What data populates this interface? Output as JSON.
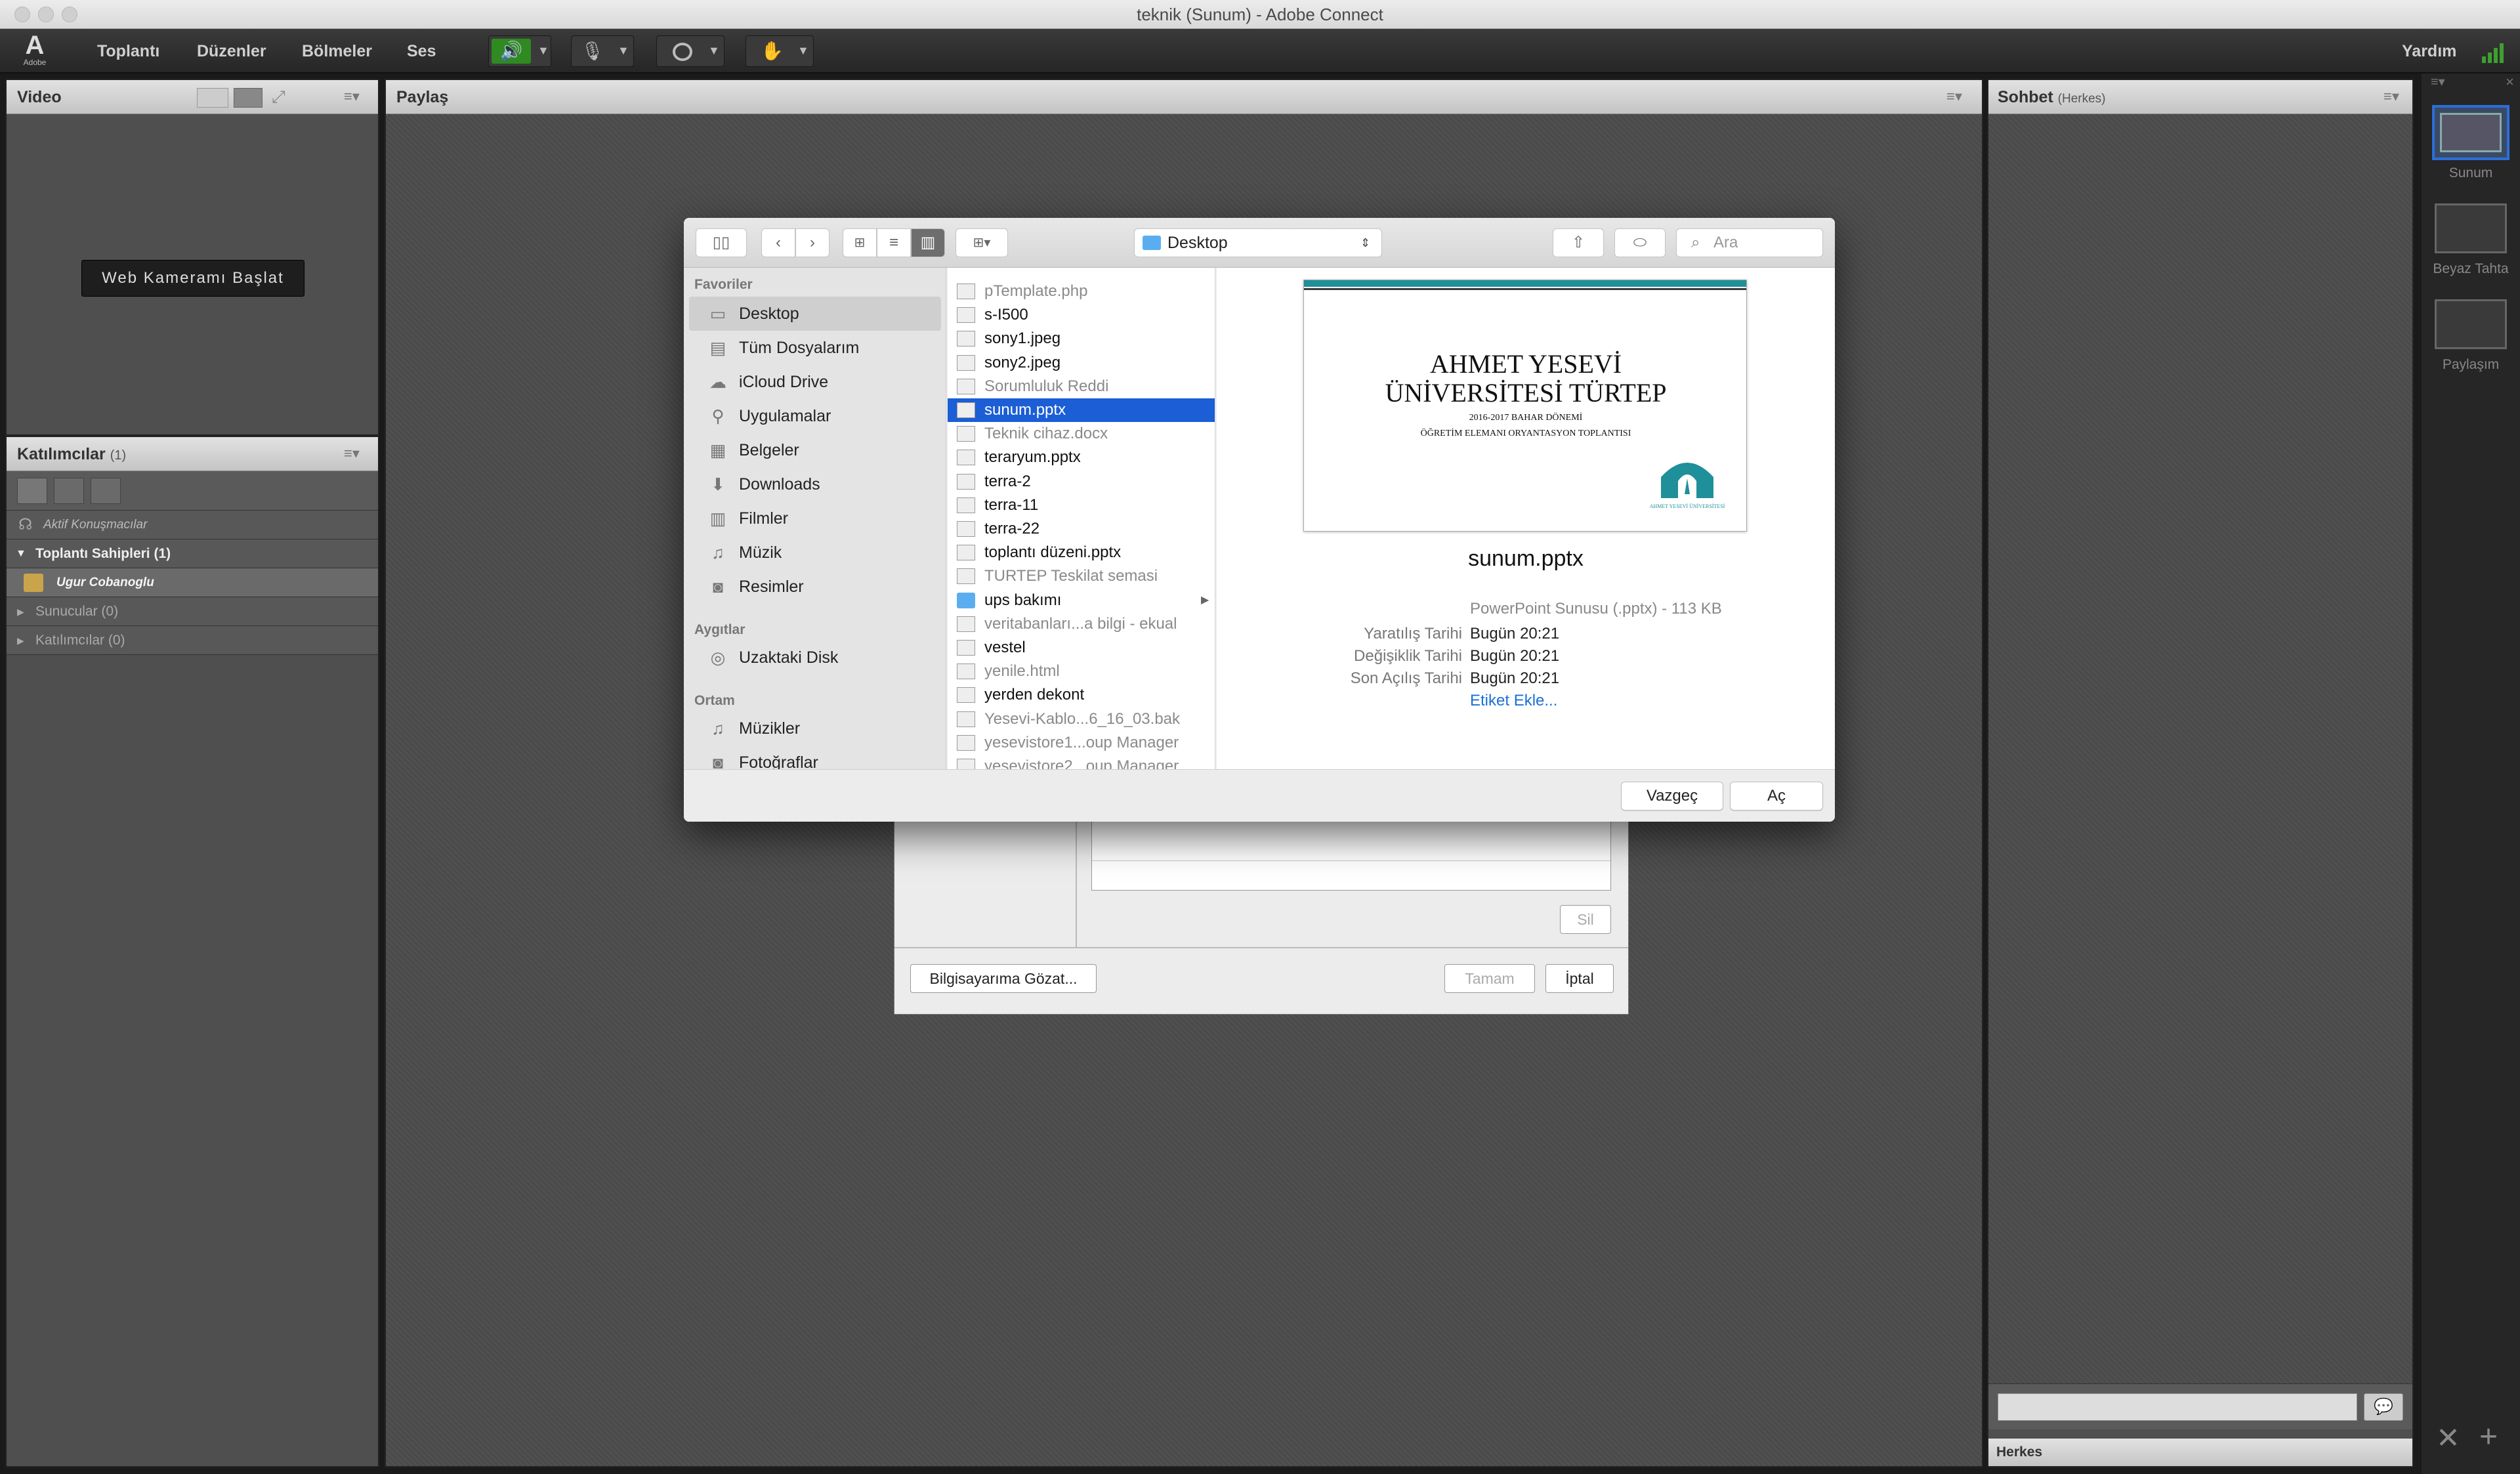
{
  "window": {
    "title": "teknik (Sunum) - Adobe Connect"
  },
  "app": {
    "logo_text": "Adobe"
  },
  "menubar": {
    "items": [
      "Toplantı",
      "Düzenler",
      "Bölmeler",
      "Ses"
    ],
    "help": "Yardım"
  },
  "video_pod": {
    "title": "Video",
    "start_button": "Web Kameramı Başlat"
  },
  "share_pod": {
    "title": "Paylaş"
  },
  "attendees_pod": {
    "title": "Katılımcılar",
    "count": "(1)",
    "active_speakers": "Aktif Konuşmacılar",
    "hosts": "Toplantı Sahipleri (1)",
    "host_user": "Ugur Cobanoglu",
    "presenters": "Sunucular (0)",
    "participants": "Katılımcılar (0)"
  },
  "chat_pod": {
    "title": "Sohbet",
    "scope": "(Herkes)",
    "footer": "Herkes"
  },
  "layouts": [
    {
      "label": "Sunum"
    },
    {
      "label": "Beyaz Tahta"
    },
    {
      "label": "Paylaşım"
    }
  ],
  "file_dialog": {
    "location": "Desktop",
    "search_placeholder": "Ara",
    "sidebar": {
      "favorites_header": "Favoriler",
      "favorites": [
        {
          "label": "Desktop",
          "icon": "desktop-icon"
        },
        {
          "label": "Tüm Dosyalarım",
          "icon": "all-files-icon"
        },
        {
          "label": "iCloud Drive",
          "icon": "cloud-icon"
        },
        {
          "label": "Uygulamalar",
          "icon": "applications-icon"
        },
        {
          "label": "Belgeler",
          "icon": "documents-icon"
        },
        {
          "label": "Downloads",
          "icon": "downloads-icon"
        },
        {
          "label": "Filmler",
          "icon": "movies-icon"
        },
        {
          "label": "Müzik",
          "icon": "music-icon"
        },
        {
          "label": "Resimler",
          "icon": "pictures-icon"
        }
      ],
      "devices_header": "Aygıtlar",
      "devices": [
        {
          "label": "Uzaktaki Disk",
          "icon": "disk-icon"
        }
      ],
      "media_header": "Ortam",
      "media": [
        {
          "label": "Müzikler",
          "icon": "music-icon"
        },
        {
          "label": "Fotoğraflar",
          "icon": "photos-icon"
        }
      ]
    },
    "files": [
      {
        "name": "pTemplate.php",
        "dim": true
      },
      {
        "name": "s-I500",
        "dim": false
      },
      {
        "name": "sony1.jpeg",
        "dim": false
      },
      {
        "name": "sony2.jpeg",
        "dim": false
      },
      {
        "name": "Sorumluluk Reddi",
        "dim": true
      },
      {
        "name": "sunum.pptx",
        "dim": false,
        "selected": true
      },
      {
        "name": "Teknik cihaz.docx",
        "dim": true
      },
      {
        "name": "teraryum.pptx",
        "dim": false
      },
      {
        "name": "terra-2",
        "dim": false
      },
      {
        "name": "terra-11",
        "dim": false
      },
      {
        "name": "terra-22",
        "dim": false
      },
      {
        "name": "toplantı düzeni.pptx",
        "dim": false
      },
      {
        "name": "TURTEP Teskilat semasi",
        "dim": true
      },
      {
        "name": "ups bakımı",
        "dim": false,
        "folder": true
      },
      {
        "name": "veritabanları...a bilgi - ekual",
        "dim": true
      },
      {
        "name": "vestel",
        "dim": false
      },
      {
        "name": "yenile.html",
        "dim": true
      },
      {
        "name": "yerden dekont",
        "dim": false
      },
      {
        "name": "Yesevi-Kablo...6_16_03.bak",
        "dim": true
      },
      {
        "name": "yesevistore1...oup Manager",
        "dim": true
      },
      {
        "name": "yesevistore2...oup Manager",
        "dim": true
      }
    ],
    "preview": {
      "slide_title_1": "AHMET YESEVİ",
      "slide_title_2": "ÜNİVERSİTESİ TÜRTEP",
      "slide_sub_1": "2016-2017 BAHAR DÖNEMİ",
      "slide_sub_2": "ÖĞRETİM ELEMANI ORYANTASYON TOPLANTISI",
      "slide_logo_text": "AHMET YESEVİ ÜNİVERSİTESİ",
      "filename": "sunum.pptx",
      "kind": "PowerPoint Sunusu (.pptx) - 113 KB",
      "meta": [
        {
          "key": "Yaratılış Tarihi",
          "value": "Bugün 20:21"
        },
        {
          "key": "Değişiklik Tarihi",
          "value": "Bugün 20:21"
        },
        {
          "key": "Son Açılış Tarihi",
          "value": "Bugün 20:21"
        }
      ],
      "add_tag": "Etiket Ekle..."
    },
    "cancel": "Vazgeç",
    "open": "Aç"
  },
  "upload_dialog": {
    "delete": "Sil",
    "browse": "Bilgisayarıma Gözat...",
    "ok": "Tamam",
    "cancel": "İptal"
  },
  "colors": {
    "selection": "#1b5ed6",
    "accent_teal": "#1f8f99",
    "link": "#1a6fd8"
  }
}
